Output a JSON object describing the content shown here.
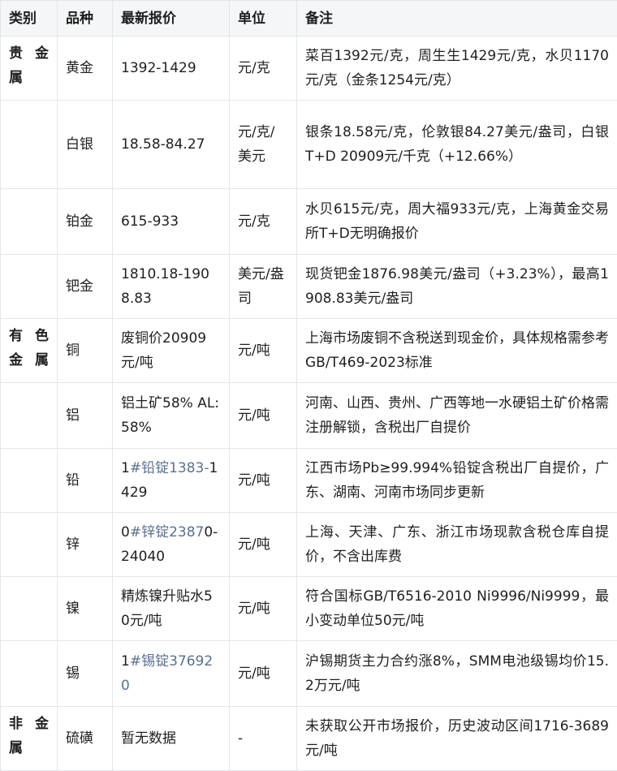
{
  "headers": [
    "类别",
    "品种",
    "最新报价",
    "单位",
    "备注"
  ],
  "rows": [
    {
      "category": "贵金属",
      "variety": "黄金",
      "price_pre": "",
      "price_link": "",
      "price_post": "1392-1429",
      "unit": "元/克",
      "note": "菜百1392元/克，周生生1429元/克，水贝1170元/克（金条1254元/克）"
    },
    {
      "category": "",
      "variety": "白银",
      "price_pre": "",
      "price_link": "",
      "price_post": "18.58-84.27",
      "unit": "元/克/美元",
      "note": "银条18.58元/克，伦敦银84.27美元/盎司，白银T+D 20909元/千克（+12.66%）"
    },
    {
      "category": "",
      "variety": "铂金",
      "price_pre": "",
      "price_link": "",
      "price_post": "615-933",
      "unit": "元/克",
      "note": "水贝615元/克，周大福933元/克，上海黄金交易所T+D无明确报价"
    },
    {
      "category": "",
      "variety": "钯金",
      "price_pre": "",
      "price_link": "",
      "price_post": "1810.18-1908.83",
      "unit": "美元/盎司",
      "note": "现货钯金1876.98美元/盎司（+3.23%），最高1908.83美元/盎司"
    },
    {
      "category": "有色金属",
      "variety": "铜",
      "price_pre": "",
      "price_link": "",
      "price_post": "废铜价20909元/吨",
      "unit": "元/吨",
      "note": "上海市场废铜不含税送到现金价，具体规格需参考GB/T469-2023标准"
    },
    {
      "category": "",
      "variety": "铝",
      "price_pre": "",
      "price_link": "",
      "price_post": "铝土矿58% AL:58%",
      "unit": "元/吨",
      "note": "河南、山西、贵州、广西等地一水硬铝土矿价格需注册解锁，含税出厂自提价"
    },
    {
      "category": "",
      "variety": "铅",
      "price_pre": "1",
      "price_link": "#铅锭1383-",
      "price_post": "1429",
      "unit": "元/吨",
      "note": "江西市场Pb≥99.994%铅锭含税出厂自提价，广东、湖南、河南市场同步更新"
    },
    {
      "category": "",
      "variety": "锌",
      "price_pre": "0",
      "price_link": "#锌锭2387",
      "price_post": "0-24040",
      "unit": "元/吨",
      "note": "上海、天津、广东、浙江市场现款含税仓库自提价，不含出库费"
    },
    {
      "category": "",
      "variety": "镍",
      "price_pre": "",
      "price_link": "",
      "price_post": "精炼镍升贴水50元/吨",
      "unit": "元/吨",
      "note": "符合国标GB/T6516-2010 Ni9996/Ni9999，最小变动单位50元/吨"
    },
    {
      "category": "",
      "variety": "锡",
      "price_pre": "1",
      "price_link": "#锡锭376920",
      "price_post": "",
      "unit": "元/吨",
      "note": "沪锡期货主力合约涨8%，SMM电池级锡均价15.2万元/吨"
    },
    {
      "category": "非金属",
      "variety": "硫磺",
      "price_pre": "",
      "price_link": "",
      "price_post": "暂无数据",
      "unit": "-",
      "note": "未获取公开市场报价，历史波动区间1716-3689元/吨"
    }
  ]
}
